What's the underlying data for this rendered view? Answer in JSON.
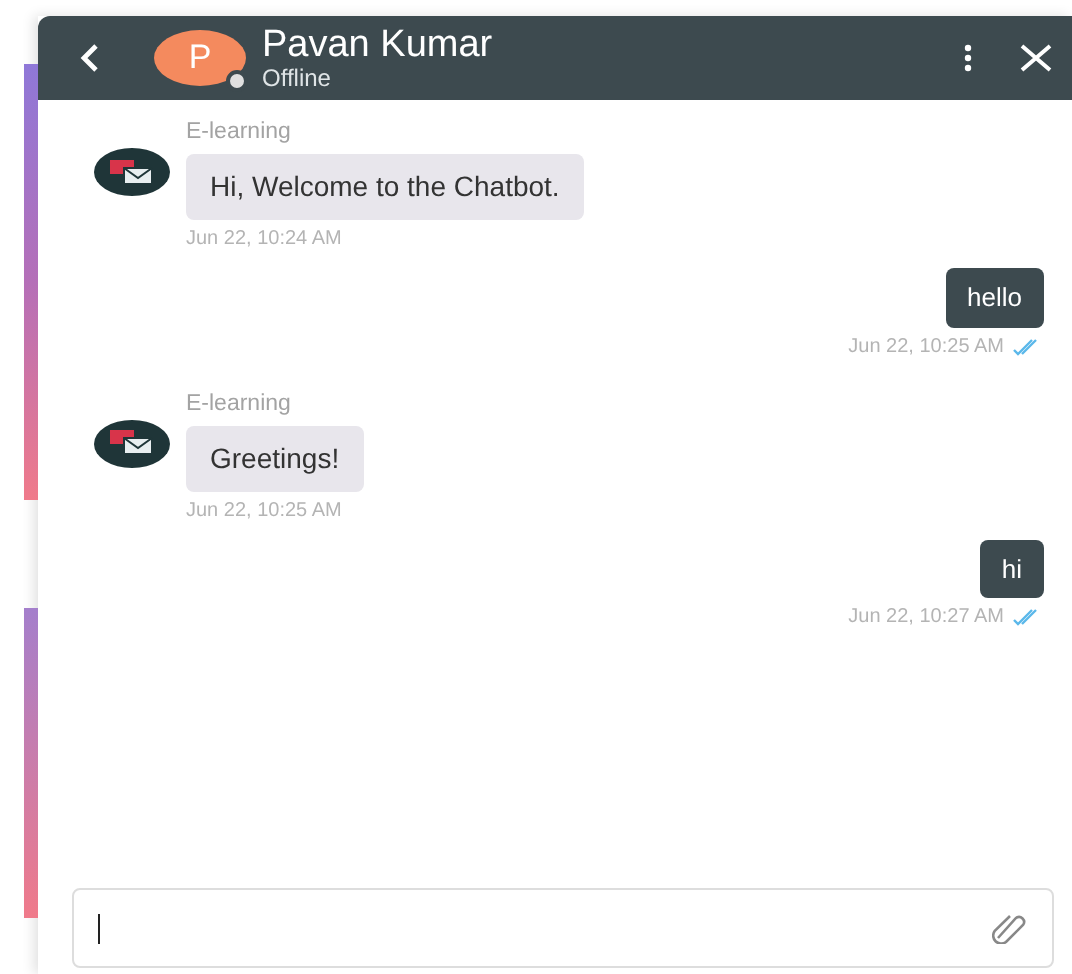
{
  "header": {
    "name": "Pavan Kumar",
    "status": "Offline",
    "avatar_letter": "P",
    "online": false
  },
  "messages": [
    {
      "kind": "bot",
      "sender": "E-learning",
      "text": "Hi, Welcome to the Chatbot.",
      "time": "Jun 22, 10:24 AM"
    },
    {
      "kind": "user",
      "text": "hello",
      "time": "Jun 22, 10:25 AM",
      "read": true
    },
    {
      "kind": "bot",
      "sender": "E-learning",
      "text": "Greetings!",
      "time": "Jun 22, 10:25 AM"
    },
    {
      "kind": "user",
      "text": "hi",
      "time": "Jun 22, 10:27 AM",
      "read": true
    }
  ],
  "composer": {
    "focused": true
  }
}
